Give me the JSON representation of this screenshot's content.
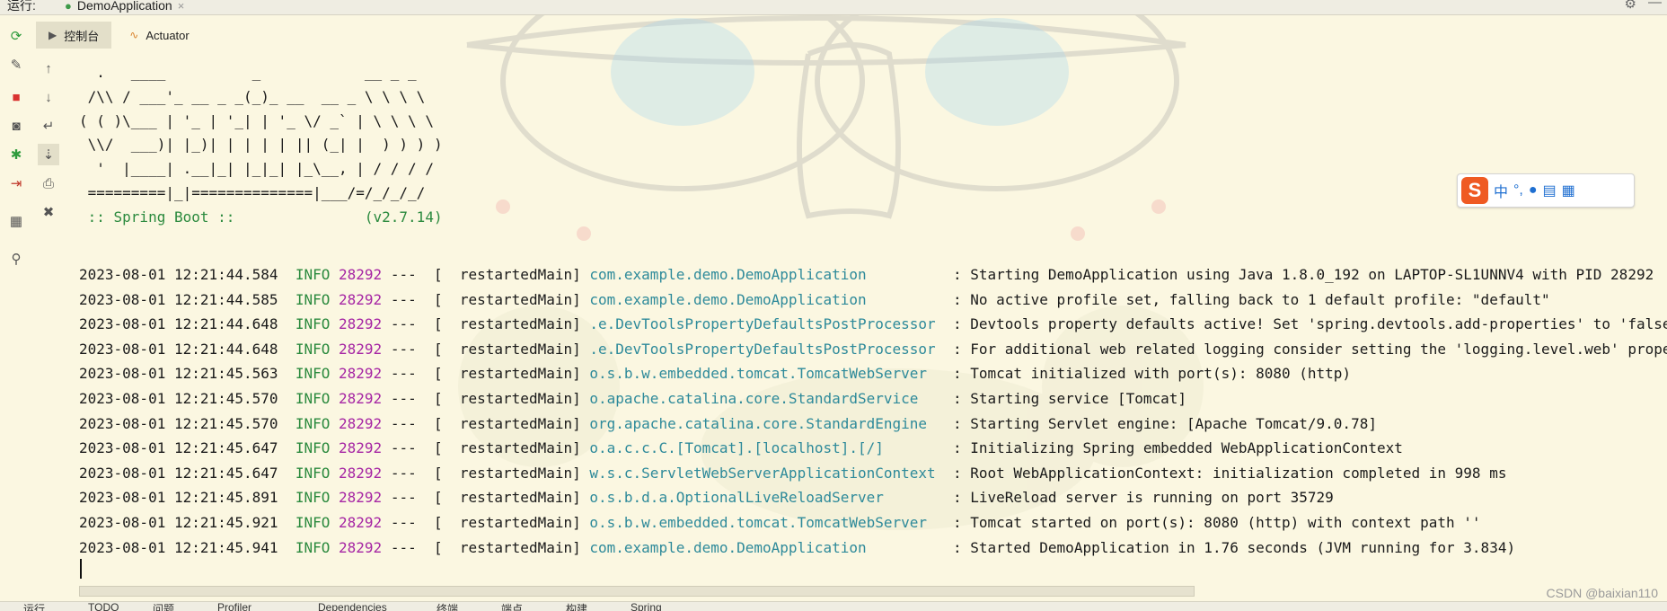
{
  "window": {
    "run_label": "运行:",
    "run_tab_label": "DemoApplication",
    "close_glyph": "×"
  },
  "tabs": [
    {
      "label": "控制台",
      "icon": "console-icon",
      "active": true
    },
    {
      "label": "Actuator",
      "icon": "actuator-icon",
      "active": false
    }
  ],
  "toolbar_left": [
    {
      "icon": "rerun-icon",
      "glyph": "⟳",
      "color": "#2e9b3c"
    },
    {
      "icon": "wrench-icon",
      "glyph": "🔧",
      "color": "#555555"
    },
    {
      "icon": "stop-icon",
      "glyph": "■",
      "color": "#d9322f"
    },
    {
      "icon": "camera-icon",
      "glyph": "📷",
      "color": "#555555"
    },
    {
      "icon": "debug-icon",
      "glyph": "✱",
      "color": "#2e9b3c"
    },
    {
      "icon": "login-icon",
      "glyph": "⇥",
      "color": "#c0392b"
    },
    {
      "icon": "layout-icon",
      "glyph": "▦",
      "color": "#555555"
    },
    {
      "icon": "pin-icon",
      "glyph": "📌",
      "color": "#555555"
    }
  ],
  "toolbar_right": [
    {
      "icon": "arrow-up-icon",
      "glyph": "↑"
    },
    {
      "icon": "arrow-down-icon",
      "glyph": "↓"
    },
    {
      "icon": "soft-wrap-icon",
      "glyph": "↵"
    },
    {
      "icon": "scroll-to-end-icon",
      "glyph": "⇣"
    },
    {
      "icon": "print-icon",
      "glyph": "⎙"
    },
    {
      "icon": "trash-icon",
      "glyph": "🗑"
    }
  ],
  "banner": [
    "  .   ____          _            __ _ _",
    " /\\\\ / ___'_ __ _ _(_)_ __  __ _ \\ \\ \\ \\",
    "( ( )\\___ | '_ | '_| | '_ \\/ _` | \\ \\ \\ \\",
    " \\\\/  ___)| |_)| | | | | || (_| |  ) ) ) )",
    "  '  |____| .__|_| |_|_| |_\\__, | / / / /",
    " =========|_|==============|___/=/_/_/_/",
    " :: Spring Boot ::               (v2.7.14)"
  ],
  "logs": [
    {
      "ts": "2023-08-01 12:21:44.584",
      "level": "INFO",
      "pid": "28292",
      "thread": "---  [  restartedMain]",
      "logger": "com.example.demo.DemoApplication        ",
      "msg": ": Starting DemoApplication using Java 1.8.0_192 on LAPTOP-SL1UNNV4 with PID 28292"
    },
    {
      "ts": "2023-08-01 12:21:44.585",
      "level": "INFO",
      "pid": "28292",
      "thread": "---  [  restartedMain]",
      "logger": "com.example.demo.DemoApplication        ",
      "msg": ": No active profile set, falling back to 1 default profile: \"default\""
    },
    {
      "ts": "2023-08-01 12:21:44.648",
      "level": "INFO",
      "pid": "28292",
      "thread": "---  [  restartedMain]",
      "logger": ".e.DevToolsPropertyDefaultsPostProcessor",
      "msg": ": Devtools property defaults active! Set 'spring.devtools.add-properties' to 'false' to disable"
    },
    {
      "ts": "2023-08-01 12:21:44.648",
      "level": "INFO",
      "pid": "28292",
      "thread": "---  [  restartedMain]",
      "logger": ".e.DevToolsPropertyDefaultsPostProcessor",
      "msg": ": For additional web related logging consider setting the 'logging.level.web' property to 'DEBUG'"
    },
    {
      "ts": "2023-08-01 12:21:45.563",
      "level": "INFO",
      "pid": "28292",
      "thread": "---  [  restartedMain]",
      "logger": "o.s.b.w.embedded.tomcat.TomcatWebServer ",
      "msg": ": Tomcat initialized with port(s): 8080 (http)"
    },
    {
      "ts": "2023-08-01 12:21:45.570",
      "level": "INFO",
      "pid": "28292",
      "thread": "---  [  restartedMain]",
      "logger": "o.apache.catalina.core.StandardService  ",
      "msg": ": Starting service [Tomcat]"
    },
    {
      "ts": "2023-08-01 12:21:45.570",
      "level": "INFO",
      "pid": "28292",
      "thread": "---  [  restartedMain]",
      "logger": "org.apache.catalina.core.StandardEngine ",
      "msg": ": Starting Servlet engine: [Apache Tomcat/9.0.78]"
    },
    {
      "ts": "2023-08-01 12:21:45.647",
      "level": "INFO",
      "pid": "28292",
      "thread": "---  [  restartedMain]",
      "logger": "o.a.c.c.C.[Tomcat].[localhost].[/]      ",
      "msg": ": Initializing Spring embedded WebApplicationContext"
    },
    {
      "ts": "2023-08-01 12:21:45.647",
      "level": "INFO",
      "pid": "28292",
      "thread": "---  [  restartedMain]",
      "logger": "w.s.c.ServletWebServerApplicationContext",
      "msg": ": Root WebApplicationContext: initialization completed in 998 ms"
    },
    {
      "ts": "2023-08-01 12:21:45.891",
      "level": "INFO",
      "pid": "28292",
      "thread": "---  [  restartedMain]",
      "logger": "o.s.b.d.a.OptionalLiveReloadServer      ",
      "msg": ": LiveReload server is running on port 35729"
    },
    {
      "ts": "2023-08-01 12:21:45.921",
      "level": "INFO",
      "pid": "28292",
      "thread": "---  [  restartedMain]",
      "logger": "o.s.b.w.embedded.tomcat.TomcatWebServer ",
      "msg": ": Tomcat started on port(s): 8080 (http) with context path ''"
    },
    {
      "ts": "2023-08-01 12:21:45.941",
      "level": "INFO",
      "pid": "28292",
      "thread": "---  [  restartedMain]",
      "logger": "com.example.demo.DemoApplication        ",
      "msg": ": Started DemoApplication in 1.76 seconds (JVM running for 3.834)"
    }
  ],
  "ime_toolbar": {
    "logo": "S",
    "items": [
      {
        "icon": "chinese-mode-icon",
        "glyph": "中"
      },
      {
        "icon": "punctuation-icon",
        "glyph": "°,"
      },
      {
        "icon": "microphone-icon",
        "glyph": "🎤"
      },
      {
        "icon": "keyboard-icon",
        "glyph": "⌨"
      },
      {
        "icon": "apps-grid-icon",
        "glyph": "▦"
      }
    ]
  },
  "bottom_bar": [
    {
      "label": "运行"
    },
    {
      "label": "TODO"
    },
    {
      "label": "问题"
    },
    {
      "label": "Profiler"
    },
    {
      "label": "Dependencies"
    },
    {
      "label": "终端"
    },
    {
      "label": "端点"
    },
    {
      "label": "构建"
    },
    {
      "label": "Spring"
    }
  ],
  "watermark": "CSDN @baixian110",
  "colors": {
    "background": "#fbf7e1",
    "info": "#2b8a3e",
    "pid": "#a626a4",
    "logger": "#2e8a9a",
    "accent": "#4a88c7"
  }
}
